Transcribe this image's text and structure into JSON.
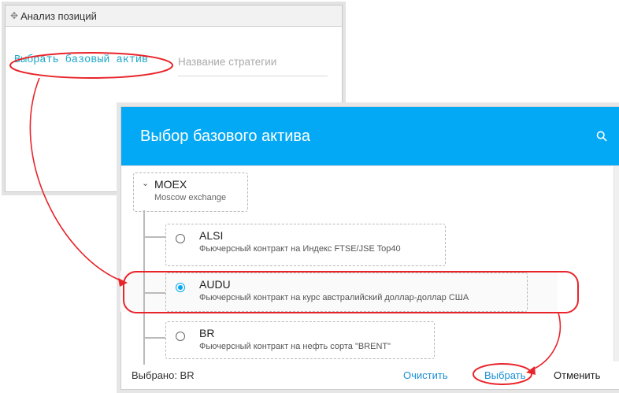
{
  "window": {
    "title": "Анализ позиций",
    "move_icon": "move-icon"
  },
  "main": {
    "base_asset_link": "Выбрать базовый актив",
    "strategy_placeholder": "Название стратегии"
  },
  "dialog": {
    "title": "Выбор базового актива",
    "search_icon": "search-icon",
    "group": {
      "name": "MOEX",
      "description": "Moscow exchange"
    },
    "items": [
      {
        "name": "ALSI",
        "description": "Фьючерсный контракт на Индекс FTSE/JSE Top40",
        "selected": false
      },
      {
        "name": "AUDU",
        "description": "Фьючерсный контракт на курс австралийский доллар-доллар США",
        "selected": true
      },
      {
        "name": "BR",
        "description": "Фьючерсный контракт на нефть сорта \"BRENT\"",
        "selected": false
      }
    ],
    "footer": {
      "selected_text": "Выбрано: BR",
      "clear_label": "Очистить",
      "choose_label": "Выбрать",
      "cancel_label": "Отменить"
    }
  },
  "annotation_color": "#e8252b",
  "accent_color": "#03a9f4"
}
